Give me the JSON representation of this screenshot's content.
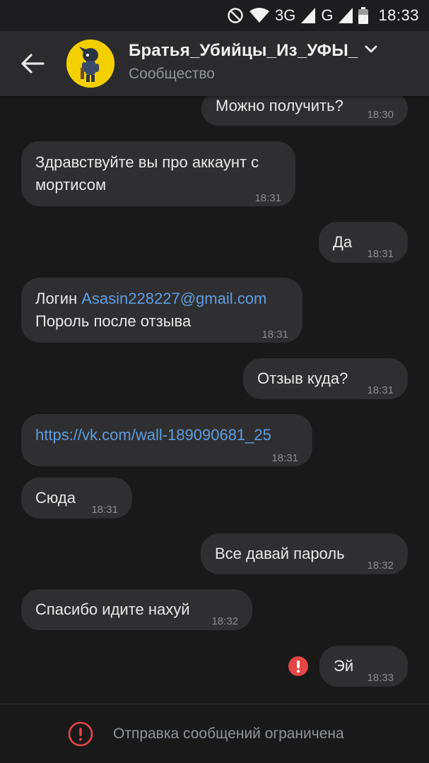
{
  "status_bar": {
    "network_3g": "3G",
    "network_g": "G",
    "time": "18:33",
    "icons": [
      "do-not-disturb-icon",
      "wifi-icon",
      "signal-icon",
      "signal-icon",
      "battery-icon"
    ]
  },
  "header": {
    "title": "Братья_Убийцы_Из_УФЫ_",
    "subtitle": "Сообщество",
    "avatar_color": "#f4d000"
  },
  "messages": [
    {
      "side": "out",
      "lines": [
        "Можно получить?"
      ],
      "time": "18:30"
    },
    {
      "side": "in",
      "lines": [
        "Здравствуйте вы про аккаунт с",
        "мортисом"
      ],
      "time": "18:31"
    },
    {
      "side": "out",
      "lines": [
        "Да"
      ],
      "time": "18:31"
    },
    {
      "side": "in",
      "line1_prefix": "Логин ",
      "line1_link": "Asasin228227@gmail.com",
      "line2": "Пороль после отзыва",
      "time": "18:31"
    },
    {
      "side": "out",
      "lines": [
        "Отзыв куда?"
      ],
      "time": "18:31"
    },
    {
      "side": "in",
      "link": "https://vk.com/wall-189090681_25",
      "time": "18:31"
    },
    {
      "side": "in",
      "lines": [
        "Сюда"
      ],
      "time": "18:31"
    },
    {
      "side": "out",
      "lines": [
        "Все давай пароль"
      ],
      "time": "18:32"
    },
    {
      "side": "in",
      "lines": [
        "Спасибо идите нахуй"
      ],
      "time": "18:32"
    },
    {
      "side": "out",
      "lines": [
        "Эй"
      ],
      "time": "18:33",
      "status": "error"
    }
  ],
  "footer": {
    "text": "Отправка сообщений ограничена"
  },
  "colors": {
    "background": "#19191a",
    "bubble": "#2f2f31",
    "header": "#2b2b2d",
    "link": "#5f9de0",
    "error": "#e64646"
  }
}
